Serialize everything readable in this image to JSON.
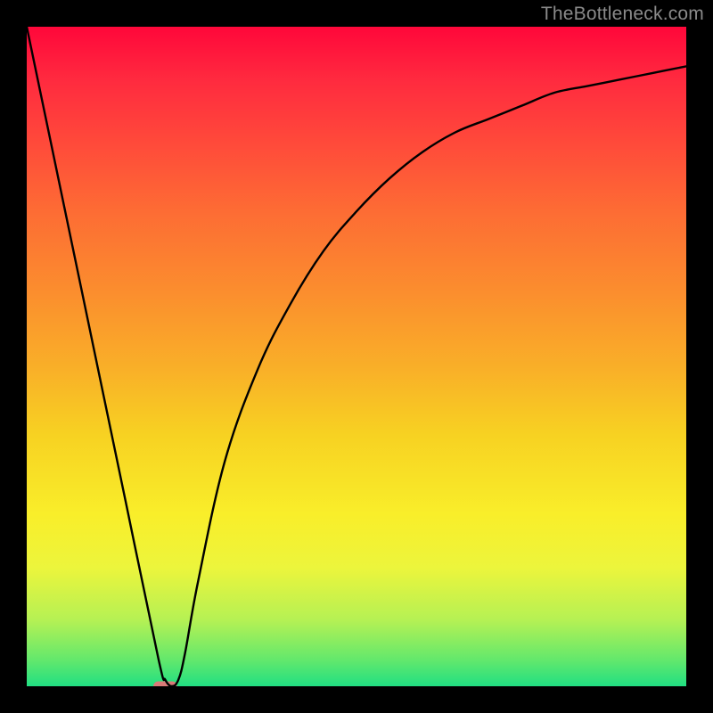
{
  "watermark": "TheBottleneck.com",
  "chart_data": {
    "type": "line",
    "title": "",
    "xlabel": "",
    "ylabel": "",
    "xlim": [
      0,
      100
    ],
    "ylim": [
      0,
      100
    ],
    "grid": false,
    "legend": false,
    "background": "heat-gradient-red-to-green",
    "series": [
      {
        "name": "bottleneck-curve",
        "x": [
          0,
          5,
          10,
          15,
          20,
          21,
          22,
          23,
          24,
          26,
          30,
          35,
          40,
          45,
          50,
          55,
          60,
          65,
          70,
          75,
          80,
          85,
          90,
          95,
          100
        ],
        "values": [
          100,
          76,
          52,
          28,
          4,
          1,
          0,
          1,
          5,
          16,
          34,
          48,
          58,
          66,
          72,
          77,
          81,
          84,
          86,
          88,
          90,
          91,
          92,
          93,
          94
        ]
      }
    ],
    "marker": {
      "shape": "rounded-rect",
      "x": 21,
      "y": 0,
      "width": 3.6,
      "height": 1.5,
      "color": "#d97b78"
    }
  }
}
